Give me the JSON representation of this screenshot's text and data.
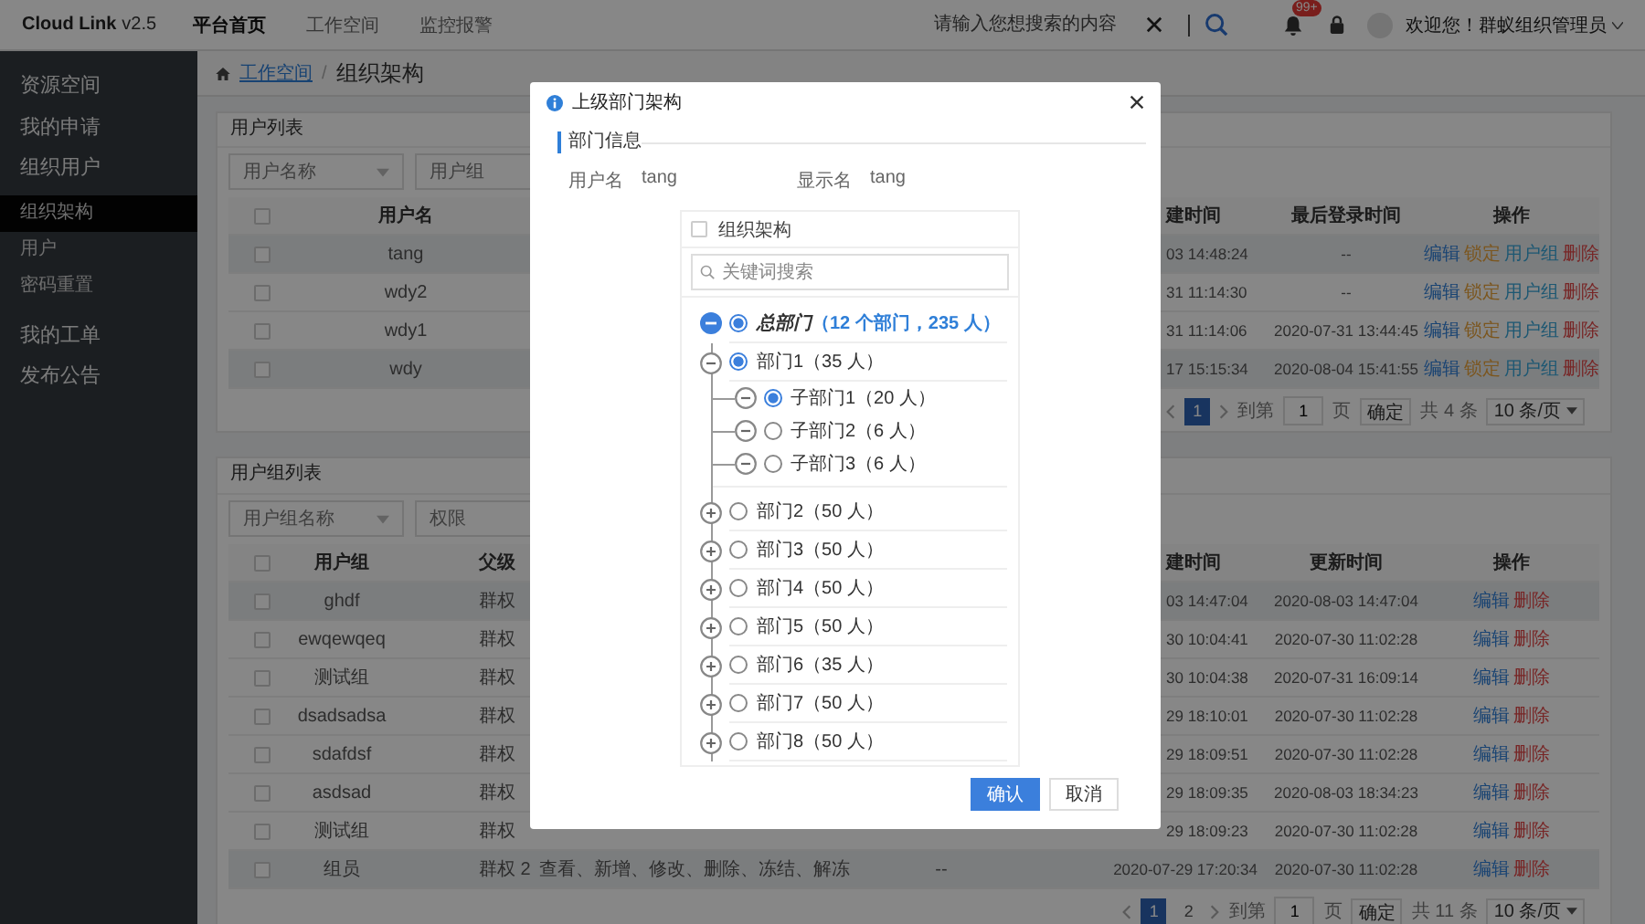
{
  "top_bar": {
    "logo": "Cloud Link",
    "version": "v2.5",
    "nav": [
      {
        "label": "平台首页",
        "selected": true
      },
      {
        "label": "工作空间",
        "selected": false
      },
      {
        "label": "监控报警",
        "selected": false
      }
    ],
    "search": {
      "placeholder": "请输入您想搜索的内容"
    },
    "notification_badge": "99+",
    "greeting": "欢迎您！群蚁组织管理员"
  },
  "sidebar": {
    "items": [
      {
        "label": "资源空间",
        "selected": false
      },
      {
        "label": "我的申请",
        "selected": false
      },
      {
        "label": "组织用户",
        "selected": false,
        "children": [
          {
            "label": "组织架构",
            "selected": true
          },
          {
            "label": "用户",
            "selected": false
          },
          {
            "label": "密码重置",
            "selected": false
          }
        ]
      },
      {
        "label": "我的工单",
        "selected": false
      },
      {
        "label": "发布公告",
        "selected": false
      }
    ]
  },
  "breadcrumb": {
    "link": "工作空间",
    "separator": "/",
    "current": "组织架构"
  },
  "user_list": {
    "title": "用户列表",
    "filters": [
      {
        "kind": "select",
        "placeholder": "用户名称"
      },
      {
        "kind": "input",
        "placeholder": "用户组"
      }
    ],
    "select_all_checked": false,
    "columns": [
      "用户名",
      "建时间",
      "最后登录时间",
      "操作"
    ],
    "rows": [
      {
        "checked": false,
        "highlighted": true,
        "name": "tang",
        "created": "03 14:48:24",
        "last_login": "--",
        "actions": [
          {
            "label": "编辑",
            "kind": "edit"
          },
          {
            "label": "锁定",
            "kind": "lock"
          },
          {
            "label": "用户组",
            "kind": "group"
          },
          {
            "label": "删除",
            "kind": "delete"
          }
        ]
      },
      {
        "checked": false,
        "highlighted": false,
        "name": "wdy2",
        "created": "31 11:14:30",
        "last_login": "--",
        "actions": [
          {
            "label": "编辑",
            "kind": "edit"
          },
          {
            "label": "锁定",
            "kind": "lock"
          },
          {
            "label": "用户组",
            "kind": "group"
          },
          {
            "label": "删除",
            "kind": "delete"
          }
        ]
      },
      {
        "checked": false,
        "highlighted": false,
        "name": "wdy1",
        "created": "31 11:14:06",
        "last_login": "2020-07-31 13:44:45",
        "actions": [
          {
            "label": "编辑",
            "kind": "edit"
          },
          {
            "label": "锁定",
            "kind": "lock"
          },
          {
            "label": "用户组",
            "kind": "group"
          },
          {
            "label": "删除",
            "kind": "delete"
          }
        ]
      },
      {
        "checked": false,
        "highlighted": true,
        "name": "wdy",
        "created": "17 15:15:34",
        "last_login": "2020-08-04 15:41:55",
        "actions": [
          {
            "label": "编辑",
            "kind": "edit"
          },
          {
            "label": "锁定",
            "kind": "lock"
          },
          {
            "label": "用户组",
            "kind": "group"
          },
          {
            "label": "删除",
            "kind": "delete"
          }
        ]
      }
    ],
    "pagination": {
      "pages": [
        {
          "label": "1",
          "selected": true
        }
      ],
      "goto_label": "到第",
      "goto_value": "1",
      "page_unit": "页",
      "confirm": "确定",
      "total": "共 4 条",
      "page_size": "10 条/页"
    }
  },
  "group_list": {
    "title": "用户组列表",
    "filters": [
      {
        "kind": "select",
        "placeholder": "用户组名称"
      },
      {
        "kind": "input",
        "placeholder": "权限"
      }
    ],
    "select_all_checked": false,
    "columns": [
      "用户组",
      "父级",
      "建时间",
      "更新时间",
      "操作"
    ],
    "rows": [
      {
        "checked": false,
        "highlighted": true,
        "group": "ghdf",
        "parent": "群权",
        "created": "03 14:47:04",
        "updated": "2020-08-03 14:47:04",
        "actions": [
          {
            "label": "编辑",
            "kind": "edit"
          },
          {
            "label": "删除",
            "kind": "delete"
          }
        ]
      },
      {
        "checked": false,
        "highlighted": false,
        "group": "ewqewqeq",
        "parent": "群权",
        "created": "30 10:04:41",
        "updated": "2020-07-30 11:02:28",
        "actions": [
          {
            "label": "编辑",
            "kind": "edit"
          },
          {
            "label": "删除",
            "kind": "delete"
          }
        ]
      },
      {
        "checked": false,
        "highlighted": false,
        "group": "测试组",
        "parent": "群权",
        "created": "30 10:04:38",
        "updated": "2020-07-31 16:09:14",
        "actions": [
          {
            "label": "编辑",
            "kind": "edit"
          },
          {
            "label": "删除",
            "kind": "delete"
          }
        ]
      },
      {
        "checked": false,
        "highlighted": false,
        "group": "dsadsadsa",
        "parent": "群权",
        "created": "29 18:10:01",
        "updated": "2020-07-30 11:02:28",
        "actions": [
          {
            "label": "编辑",
            "kind": "edit"
          },
          {
            "label": "删除",
            "kind": "delete"
          }
        ]
      },
      {
        "checked": false,
        "highlighted": false,
        "group": "sdafdsf",
        "parent": "群权",
        "created": "29 18:09:51",
        "updated": "2020-07-30 11:02:28",
        "actions": [
          {
            "label": "编辑",
            "kind": "edit"
          },
          {
            "label": "删除",
            "kind": "delete"
          }
        ]
      },
      {
        "checked": false,
        "highlighted": false,
        "group": "asdsad",
        "parent": "群权",
        "created": "29 18:09:35",
        "updated": "2020-08-03 18:34:23",
        "actions": [
          {
            "label": "编辑",
            "kind": "edit"
          },
          {
            "label": "删除",
            "kind": "delete"
          }
        ]
      },
      {
        "checked": false,
        "highlighted": false,
        "group": "测试组",
        "parent": "群权",
        "created": "29 18:09:23",
        "updated": "2020-07-30 11:02:28",
        "actions": [
          {
            "label": "编辑",
            "kind": "edit"
          },
          {
            "label": "删除",
            "kind": "delete"
          }
        ]
      },
      {
        "checked": false,
        "highlighted": true,
        "group": "组员",
        "parent": "群权 2",
        "permissions": "查看、新增、修改、删除、冻结、解冻",
        "column_4": "--",
        "created": "2020-07-29 17:20:34",
        "updated": "2020-07-30 11:02:28",
        "actions": [
          {
            "label": "编辑",
            "kind": "edit"
          },
          {
            "label": "删除",
            "kind": "delete"
          }
        ]
      }
    ],
    "pagination": {
      "pages": [
        {
          "label": "1",
          "selected": true
        },
        {
          "label": "2",
          "selected": false
        }
      ],
      "goto_label": "到第",
      "goto_value": "1",
      "page_unit": "页",
      "confirm": "确定",
      "total": "共 11 条",
      "page_size": "10 条/页"
    }
  },
  "modal": {
    "title": "上级部门架构",
    "section": "部门信息",
    "fields": [
      {
        "label": "用户名",
        "value": "tang"
      },
      {
        "label": "显示名",
        "value": "tang"
      }
    ],
    "tree_panel": {
      "header_checkbox": {
        "label": "组织架构",
        "checked": false
      },
      "search": {
        "placeholder": "关键词搜索"
      },
      "tree": [
        {
          "label": "总部门",
          "count": "（12 个部门，235 人）",
          "expanded": true,
          "selected": true,
          "children": [
            {
              "label": "部门1（35 人）",
              "expanded": true,
              "selected": true,
              "children": [
                {
                  "label": "子部门1（20 人）",
                  "expanded": true,
                  "selected": true
                },
                {
                  "label": "子部门2（6 人）",
                  "expanded": true,
                  "selected": false
                },
                {
                  "label": "子部门3（6 人）",
                  "expanded": true,
                  "selected": false
                }
              ]
            },
            {
              "label": "部门2（50 人）",
              "expanded": false,
              "selected": false
            },
            {
              "label": "部门3（50 人）",
              "expanded": false,
              "selected": false
            },
            {
              "label": "部门4（50 人）",
              "expanded": false,
              "selected": false
            },
            {
              "label": "部门5（50 人）",
              "expanded": false,
              "selected": false
            },
            {
              "label": "部门6（35 人）",
              "expanded": false,
              "selected": false
            },
            {
              "label": "部门7（50 人）",
              "expanded": false,
              "selected": false
            },
            {
              "label": "部门8（50 人）",
              "expanded": false,
              "selected": false
            }
          ]
        }
      ]
    },
    "buttons": [
      {
        "label": "确认",
        "kind": "primary"
      },
      {
        "label": "取消",
        "kind": "default"
      }
    ]
  }
}
